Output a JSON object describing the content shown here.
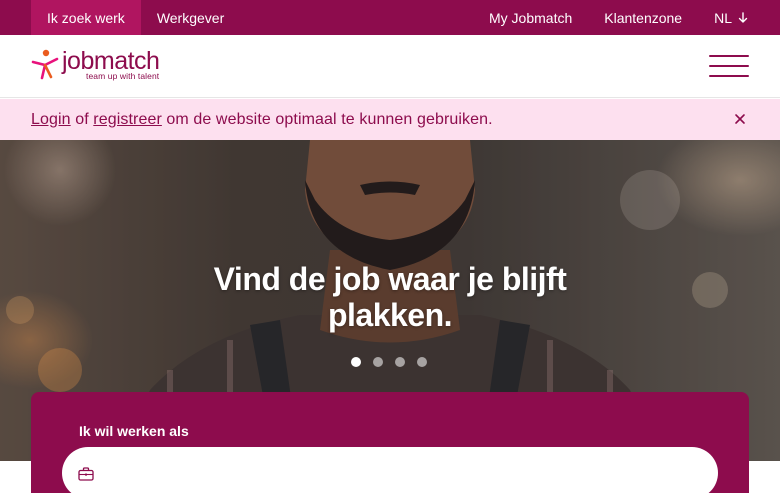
{
  "topbar": {
    "tabs": [
      {
        "label": "Ik zoek werk",
        "active": true
      },
      {
        "label": "Werkgever",
        "active": false
      }
    ],
    "right_links": {
      "my_jobmatch": "My Jobmatch",
      "klantenzone": "Klantenzone",
      "language": "NL",
      "language_icon": "arrow-down-icon"
    }
  },
  "header": {
    "logo_word_job": "job",
    "logo_word_match": "match",
    "logo_tagline": "team up with talent",
    "menu_icon": "hamburger-menu-icon"
  },
  "banner": {
    "login": "Login",
    "of": " of ",
    "register": "registreer",
    "rest": " om de website optimaal te kunnen gebruiken.",
    "close_icon": "close-icon"
  },
  "hero": {
    "title_line1": "Vind de job waar je blijft",
    "title_line2": "plakken.",
    "slides_total": 4,
    "active_slide": 1
  },
  "search": {
    "label": "Ik wil werken als",
    "input_value": "",
    "icon": "briefcase-icon"
  },
  "colors": {
    "brand": "#8d0c4d",
    "brand_light": "#b01560",
    "banner_bg": "#fde0ef",
    "white": "#ffffff"
  }
}
